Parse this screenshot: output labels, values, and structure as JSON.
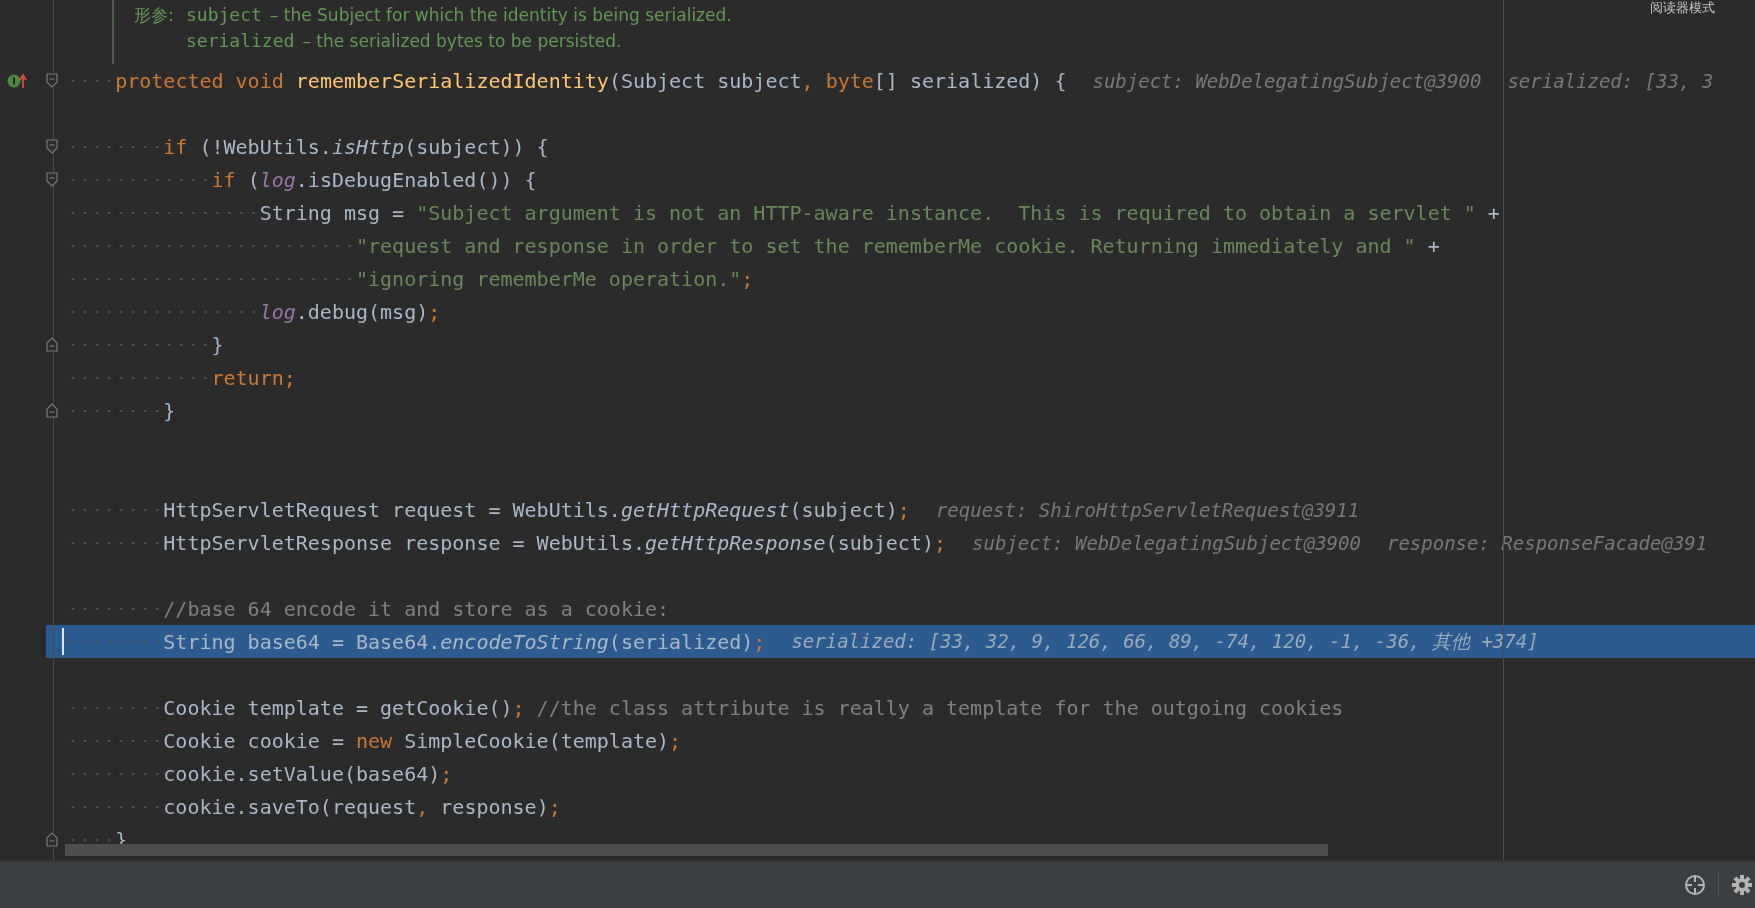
{
  "doc": {
    "label": "形参:",
    "params": [
      {
        "name": "subject",
        "description": "– the Subject for which the identity is being serialized."
      },
      {
        "name": "serialized",
        "description": "– the serialized bytes to be persisted."
      }
    ]
  },
  "reader_mode": "阅读器模式",
  "lines": [
    {
      "selected": false,
      "override_mark": true,
      "fold_start": true,
      "fold_end": false,
      "tokens": [
        {
          "text": "    protected void ",
          "kind": "keyword"
        },
        {
          "text": "rememberSerializedIdentity",
          "kind": "declaration"
        },
        {
          "text": "(Subject subject",
          "kind": "plain"
        },
        {
          "text": ", ",
          "kind": "punct"
        },
        {
          "text": "byte",
          "kind": "keyword"
        },
        {
          "text": "[] serialized) {",
          "kind": "plain"
        }
      ],
      "hints": [
        "subject: WebDelegatingSubject@3900",
        "serialized: [33, 3"
      ]
    },
    {
      "selected": false,
      "override_mark": false,
      "fold_start": false,
      "fold_end": false
    },
    {
      "selected": false,
      "override_mark": false,
      "fold_start": true,
      "fold_end": false,
      "tokens": [
        {
          "text": "        if ",
          "kind": "keyword"
        },
        {
          "text": "(!WebUtils.",
          "kind": "plain"
        },
        {
          "text": "isHttp",
          "kind": "static"
        },
        {
          "text": "(subject)) {",
          "kind": "plain"
        }
      ]
    },
    {
      "selected": false,
      "override_mark": false,
      "fold_start": true,
      "fold_end": false,
      "tokens": [
        {
          "text": "            if ",
          "kind": "keyword"
        },
        {
          "text": "(",
          "kind": "plain"
        },
        {
          "text": "log",
          "kind": "field"
        },
        {
          "text": ".isDebugEnabled()) {",
          "kind": "plain"
        }
      ]
    },
    {
      "selected": false,
      "override_mark": false,
      "fold_start": false,
      "fold_end": false,
      "tokens": [
        {
          "text": "                String msg = ",
          "kind": "plain"
        },
        {
          "text": "\"Subject argument is not an HTTP-aware instance.  This is required to obtain a servlet \"",
          "kind": "string"
        },
        {
          "text": " +",
          "kind": "plain"
        }
      ]
    },
    {
      "selected": false,
      "override_mark": false,
      "fold_start": false,
      "fold_end": false,
      "tokens": [
        {
          "text": "                        \"request and response in order to set the rememberMe cookie. Returning immediately and \"",
          "kind": "string"
        },
        {
          "text": " +",
          "kind": "plain"
        }
      ]
    },
    {
      "selected": false,
      "override_mark": false,
      "fold_start": false,
      "fold_end": false,
      "tokens": [
        {
          "text": "                        \"ignoring rememberMe operation.\"",
          "kind": "string"
        },
        {
          "text": ";",
          "kind": "punct"
        }
      ]
    },
    {
      "selected": false,
      "override_mark": false,
      "fold_start": false,
      "fold_end": false,
      "tokens": [
        {
          "text": "                log",
          "kind": "field"
        },
        {
          "text": ".debug(msg)",
          "kind": "plain"
        },
        {
          "text": ";",
          "kind": "punct"
        }
      ]
    },
    {
      "selected": false,
      "override_mark": false,
      "fold_start": false,
      "fold_end": true,
      "tokens": [
        {
          "text": "            }",
          "kind": "plain"
        }
      ]
    },
    {
      "selected": false,
      "override_mark": false,
      "fold_start": false,
      "fold_end": false,
      "tokens": [
        {
          "text": "            return",
          "kind": "keyword"
        },
        {
          "text": ";",
          "kind": "punct"
        }
      ]
    },
    {
      "selected": false,
      "override_mark": false,
      "fold_start": false,
      "fold_end": true,
      "tokens": [
        {
          "text": "        }",
          "kind": "plain"
        }
      ]
    },
    {
      "selected": false,
      "override_mark": false,
      "fold_start": false,
      "fold_end": false
    },
    {
      "selected": false,
      "override_mark": false,
      "fold_start": false,
      "fold_end": false
    },
    {
      "selected": false,
      "override_mark": false,
      "fold_start": false,
      "fold_end": false,
      "tokens": [
        {
          "text": "        HttpServletRequest request = WebUtils.",
          "kind": "plain"
        },
        {
          "text": "getHttpRequest",
          "kind": "static"
        },
        {
          "text": "(subject)",
          "kind": "plain"
        },
        {
          "text": ";",
          "kind": "punct"
        }
      ],
      "hints": [
        "request: ShiroHttpServletRequest@3911"
      ]
    },
    {
      "selected": false,
      "override_mark": false,
      "fold_start": false,
      "fold_end": false,
      "tokens": [
        {
          "text": "        HttpServletResponse response = WebUtils.",
          "kind": "plain"
        },
        {
          "text": "getHttpResponse",
          "kind": "static"
        },
        {
          "text": "(subject)",
          "kind": "plain"
        },
        {
          "text": ";",
          "kind": "punct"
        }
      ],
      "hints": [
        "subject: WebDelegatingSubject@3900",
        "response: ResponseFacade@391"
      ]
    },
    {
      "selected": false,
      "override_mark": false,
      "fold_start": false,
      "fold_end": false
    },
    {
      "selected": false,
      "override_mark": false,
      "fold_start": false,
      "fold_end": false,
      "tokens": [
        {
          "text": "        //base 64 encode it and store as a cookie:",
          "kind": "comment"
        }
      ]
    },
    {
      "selected": true,
      "override_mark": false,
      "fold_start": false,
      "fold_end": false,
      "tokens": [
        {
          "text": "        String base64 = Base64.",
          "kind": "plain"
        },
        {
          "text": "encodeToString",
          "kind": "static"
        },
        {
          "text": "(serialized)",
          "kind": "plain"
        },
        {
          "text": ";",
          "kind": "punct"
        }
      ],
      "hints": [
        "serialized: [33, 32, 9, 126, 66, 89, -74, 120, -1, -36, 其他 +374]"
      ]
    },
    {
      "selected": false,
      "override_mark": false,
      "fold_start": false,
      "fold_end": false
    },
    {
      "selected": false,
      "override_mark": false,
      "fold_start": false,
      "fold_end": false,
      "tokens": [
        {
          "text": "        Cookie template = getCookie()",
          "kind": "plain"
        },
        {
          "text": ";",
          "kind": "punct"
        },
        {
          "text": " //the class attribute is really a template for the outgoing cookies",
          "kind": "comment"
        }
      ]
    },
    {
      "selected": false,
      "override_mark": false,
      "fold_start": false,
      "fold_end": false,
      "tokens": [
        {
          "text": "        Cookie cookie = ",
          "kind": "plain"
        },
        {
          "text": "new ",
          "kind": "keyword"
        },
        {
          "text": "SimpleCookie(template)",
          "kind": "plain"
        },
        {
          "text": ";",
          "kind": "punct"
        }
      ]
    },
    {
      "selected": false,
      "override_mark": false,
      "fold_start": false,
      "fold_end": false,
      "tokens": [
        {
          "text": "        cookie.setValue(base64)",
          "kind": "plain"
        },
        {
          "text": ";",
          "kind": "punct"
        }
      ]
    },
    {
      "selected": false,
      "override_mark": false,
      "fold_start": false,
      "fold_end": false,
      "tokens": [
        {
          "text": "        cookie.saveTo(request",
          "kind": "plain"
        },
        {
          "text": ", ",
          "kind": "punct"
        },
        {
          "text": "response)",
          "kind": "plain"
        },
        {
          "text": ";",
          "kind": "punct"
        }
      ]
    },
    {
      "selected": false,
      "override_mark": false,
      "fold_start": false,
      "fold_end": true,
      "tokens": [
        {
          "text": "    }",
          "kind": "plain"
        }
      ]
    }
  ]
}
